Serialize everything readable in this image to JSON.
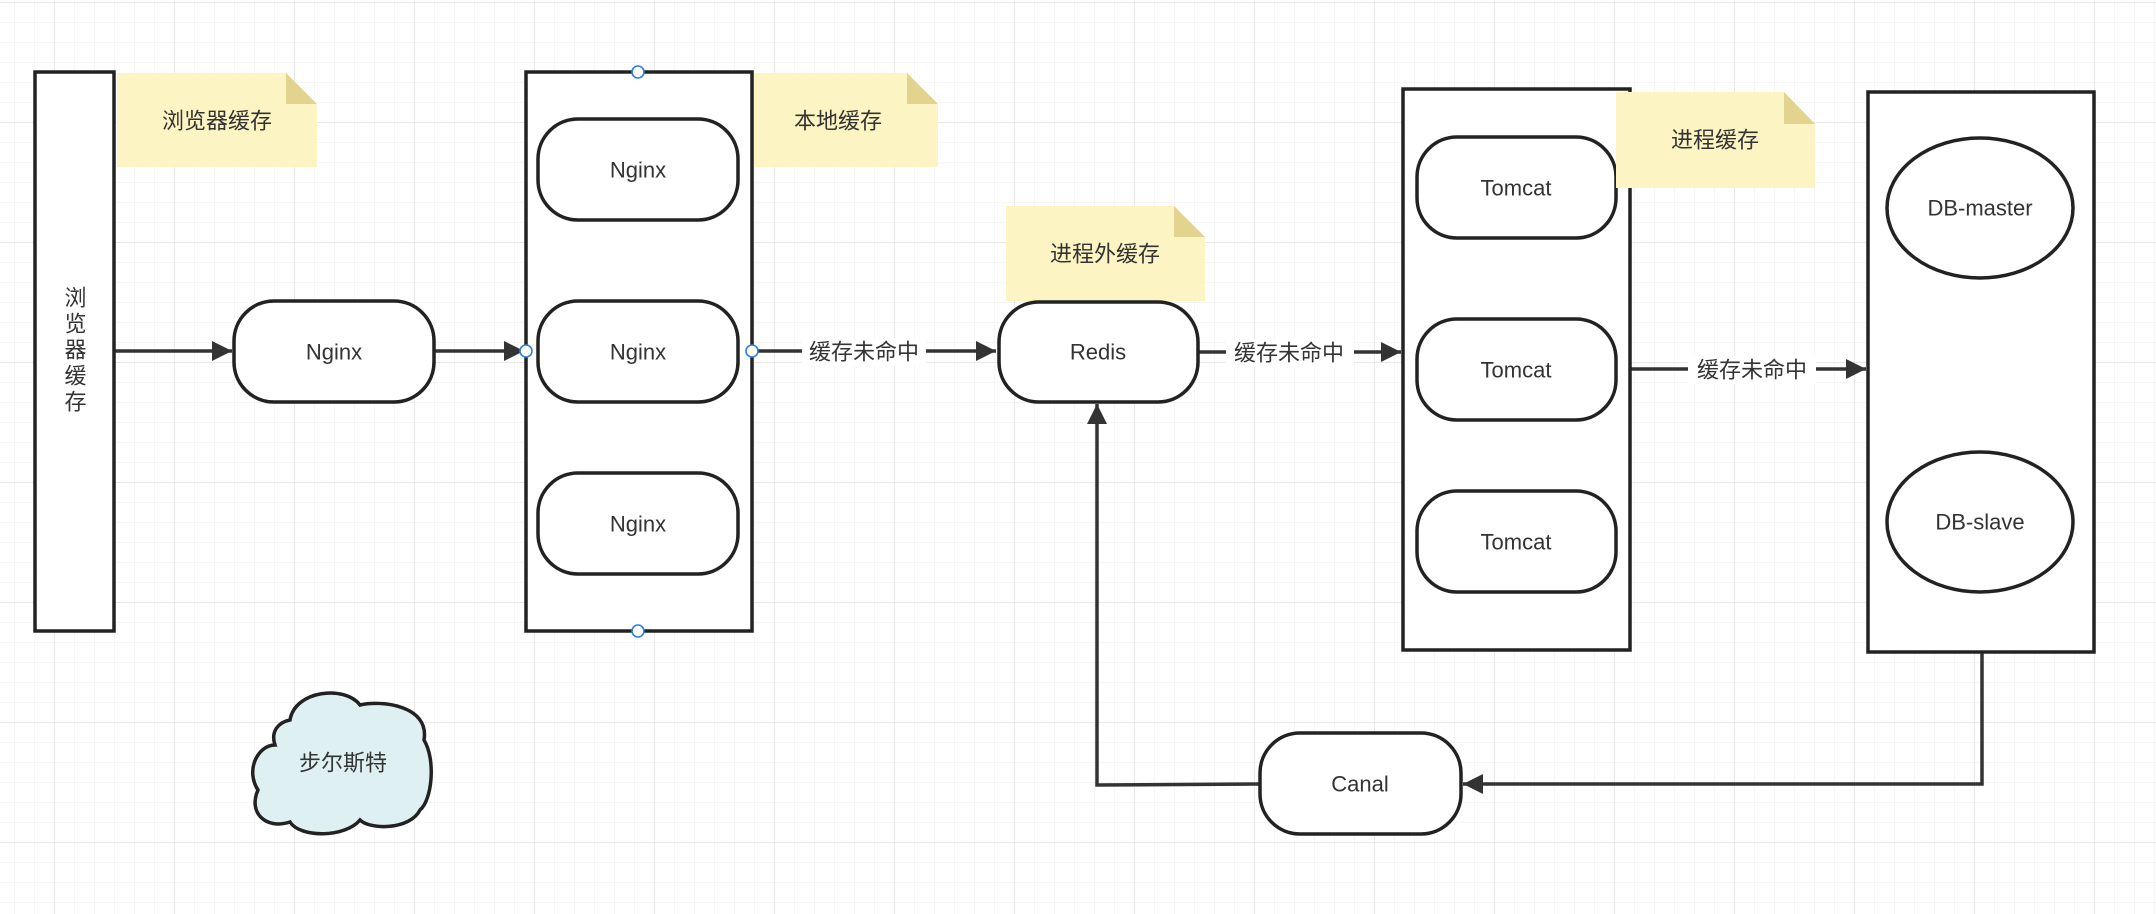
{
  "diagram": {
    "browser_column": "浏览器缓存",
    "notes": {
      "browser": "浏览器缓存",
      "local": "本地缓存",
      "out_of_process": "进程外缓存",
      "in_process": "进程缓存"
    },
    "nodes": {
      "nginx_entry": "Nginx",
      "nginx_group": [
        "Nginx",
        "Nginx",
        "Nginx"
      ],
      "redis": "Redis",
      "tomcat_group": [
        "Tomcat",
        "Tomcat",
        "Tomcat"
      ],
      "db_master": "DB-master",
      "db_slave": "DB-slave",
      "canal": "Canal",
      "cloud": "步尔斯特"
    },
    "edge_labels": {
      "nginx_to_redis": "缓存未命中",
      "redis_to_tomcat": "缓存未命中",
      "tomcat_to_db": "缓存未命中"
    },
    "colors": {
      "note": "#fcf4c2",
      "cloud": "#dff0f3",
      "selection_handle": "#2f7de1"
    }
  }
}
